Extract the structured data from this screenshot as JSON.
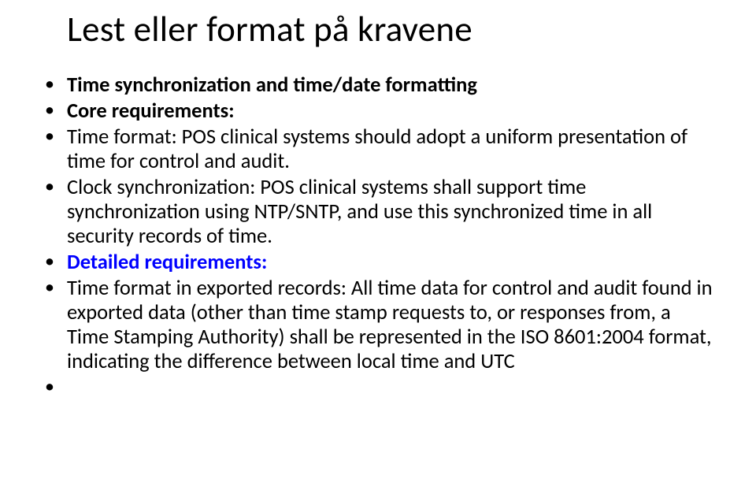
{
  "title": "Lest eller format på kravene",
  "items": [
    {
      "text": "Time synchronization and time/date formatting",
      "bold": true,
      "blue": false
    },
    {
      "text": "Core requirements:",
      "bold": true,
      "blue": false
    },
    {
      "text": "Time format: POS clinical systems should adopt a uniform presentation of time for control and audit.",
      "bold": false,
      "blue": false
    },
    {
      "text": "Clock synchronization:  POS clinical systems shall support time synchronization using NTP/SNTP, and use this synchronized time in all security records of time.",
      "bold": false,
      "blue": false
    },
    {
      "text": "Detailed requirements:",
      "bold": true,
      "blue": true
    },
    {
      "text": "Time format in exported records: All time data for control and audit found in exported data (other than time stamp requests to, or responses from, a Time Stamping Authority) shall be represented in the ISO 8601:2004 format, indicating the difference between local time and UTC",
      "bold": false,
      "blue": false
    },
    {
      "text": "",
      "bold": false,
      "blue": false
    }
  ]
}
